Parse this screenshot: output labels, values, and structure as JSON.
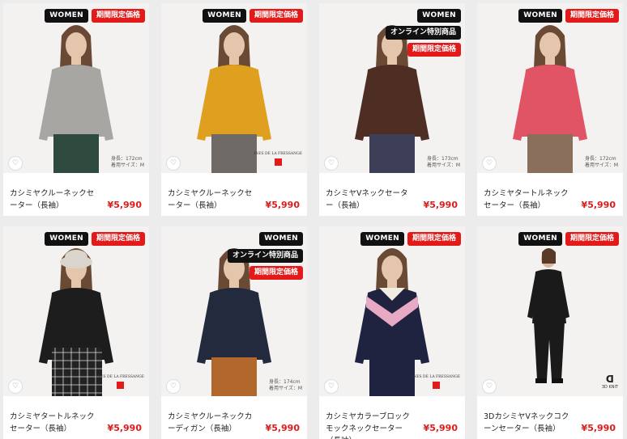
{
  "colors": {
    "sale": "#e21a1a",
    "badge_dark": "#111111",
    "background": "#ececec"
  },
  "products": [
    {
      "badges": [
        "WOMEN",
        "期間限定価格"
      ],
      "name": "カシミヤクルーネックセーター（長袖）",
      "price": "¥5,990",
      "model_height": "身長：172cm",
      "model_size": "着用サイズ：M",
      "brand": "",
      "sweater": "#a7a6a2",
      "bottom": "#2f4b3f",
      "pattern": ""
    },
    {
      "badges": [
        "WOMEN",
        "期間限定価格"
      ],
      "name": "カシミヤクルーネックセーター（長袖）",
      "price": "¥5,990",
      "model_height": "",
      "model_size": "",
      "brand": "INES DE LA FRESSANGE",
      "sweater": "#e0a01f",
      "bottom": "#6f6a66",
      "pattern": ""
    },
    {
      "badges": [
        "WOMEN",
        "オンライン特別商品",
        "期間限定価格"
      ],
      "name": "カシミヤVネックセーター（長袖）",
      "price": "¥5,990",
      "model_height": "身長：173cm",
      "model_size": "着用サイズ：M",
      "brand": "",
      "sweater": "#4e2d23",
      "bottom": "#3d3f56",
      "pattern": ""
    },
    {
      "badges": [
        "WOMEN",
        "期間限定価格"
      ],
      "name": "カシミヤタートルネックセーター（長袖）",
      "price": "¥5,990",
      "model_height": "身長：172cm",
      "model_size": "着用サイズ：M",
      "brand": "",
      "sweater": "#e05466",
      "bottom": "#8a6f5c",
      "pattern": ""
    },
    {
      "badges": [
        "WOMEN",
        "期間限定価格"
      ],
      "name": "カシミヤタートルネックセーター（長袖）",
      "price": "¥5,990",
      "model_height": "",
      "model_size": "",
      "brand": "INES DE LA FRESSANGE",
      "sweater": "#1d1d1d",
      "bottom": "#2b2b2b",
      "pattern": "check"
    },
    {
      "badges": [
        "WOMEN",
        "オンライン特別商品",
        "期間限定価格"
      ],
      "name": "カシミヤクルーネックカーディガン（長袖）",
      "price": "¥5,990",
      "model_height": "身長：174cm",
      "model_size": "着用サイズ：M",
      "brand": "",
      "sweater": "#232a3d",
      "bottom": "#b2682c",
      "pattern": ""
    },
    {
      "badges": [
        "WOMEN",
        "期間限定価格"
      ],
      "name": "カシミヤカラーブロックモックネックセーター（長袖）",
      "price": "¥5,990",
      "model_height": "",
      "model_size": "",
      "brand": "INES DE LA FRESSANGE",
      "sweater": "#1f2340",
      "bottom": "#1f2340",
      "pattern": "chevron"
    },
    {
      "badges": [
        "WOMEN",
        "期間限定価格"
      ],
      "name": "3DカシミヤVネックコクーンセーター（長袖）",
      "price": "¥5,990",
      "model_height": "",
      "model_size": "",
      "brand": "3D KNIT",
      "sweater": "#1a1a1a",
      "bottom": "#1a1a1a",
      "pattern": "full"
    }
  ],
  "ui": {
    "favorite_icon": "heart-icon"
  }
}
